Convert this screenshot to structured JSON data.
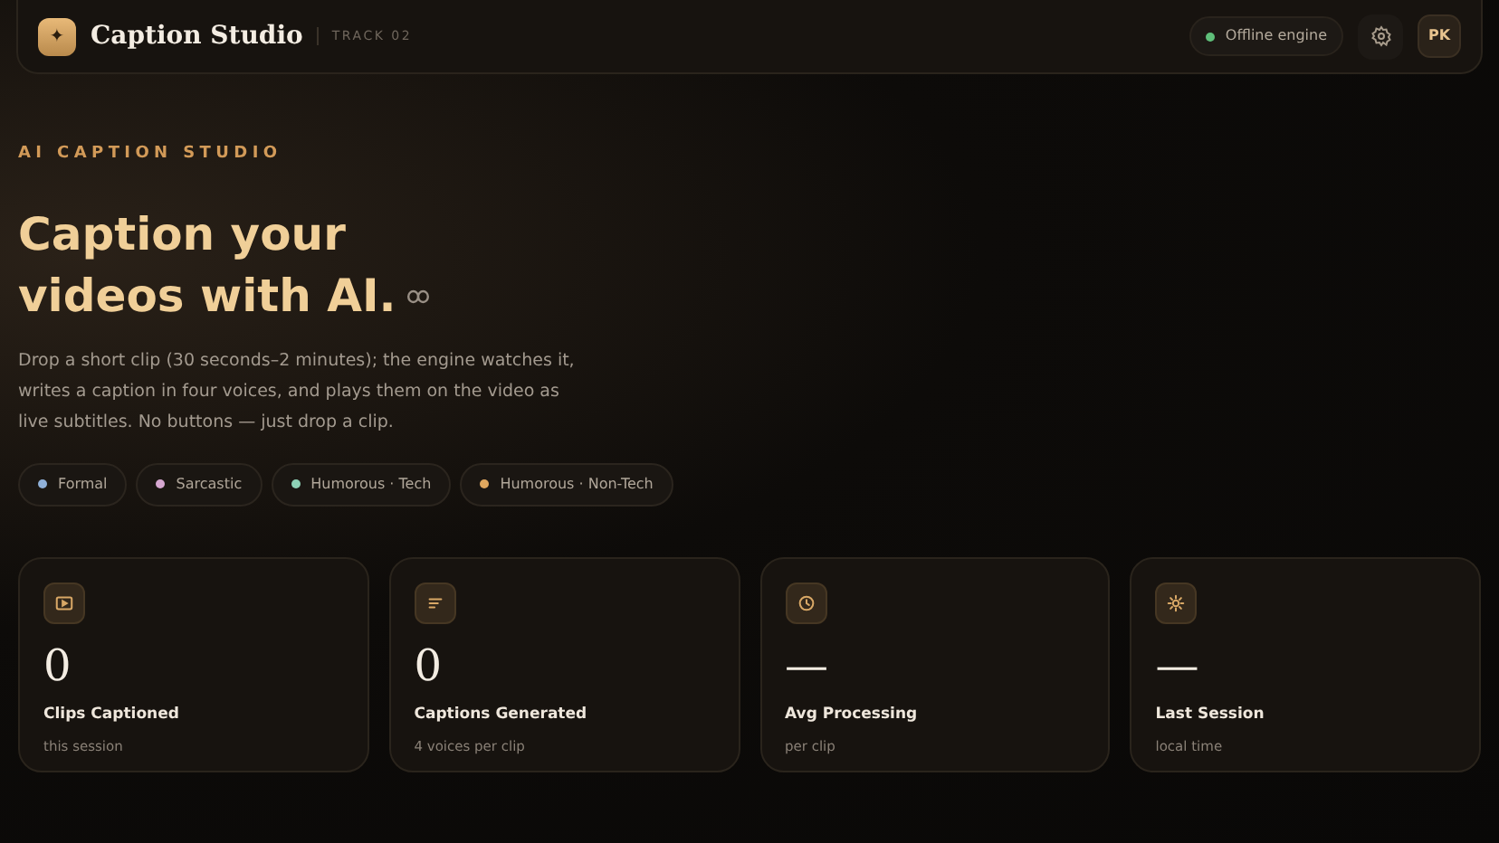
{
  "header": {
    "logo": "✦",
    "title": "Caption Studio",
    "track": "TRACK 02",
    "engine": {
      "label": "Offline engine",
      "color": "#5fbf7a"
    },
    "avatar": "PK"
  },
  "hero": {
    "eyebrow": "AI CAPTION STUDIO",
    "heading_line_1": "Caption your",
    "heading_line_2": "videos with AI.",
    "description": "Drop a short clip (30 seconds–2 minutes); the engine watches it, writes a caption in four voices, and plays them on the video as live subtitles. No buttons — just drop a clip."
  },
  "voices": [
    {
      "label": "Formal",
      "color": "#8fb0d8"
    },
    {
      "label": "Sarcastic",
      "color": "#d6a7d0"
    },
    {
      "label": "Humorous · Tech",
      "color": "#8ed1b6"
    },
    {
      "label": "Humorous · Non-Tech",
      "color": "#e0a75e"
    }
  ],
  "stats": [
    {
      "kind": "video",
      "value": "0",
      "label": "Clips Captioned",
      "note": "this session"
    },
    {
      "kind": "lines",
      "value": "0",
      "label": "Captions Generated",
      "note": "4 voices per clip"
    },
    {
      "kind": "clock",
      "value": "—",
      "label": "Avg Processing",
      "note": "per clip"
    },
    {
      "kind": "sun",
      "value": "—",
      "label": "Last Session",
      "note": "local time"
    }
  ]
}
